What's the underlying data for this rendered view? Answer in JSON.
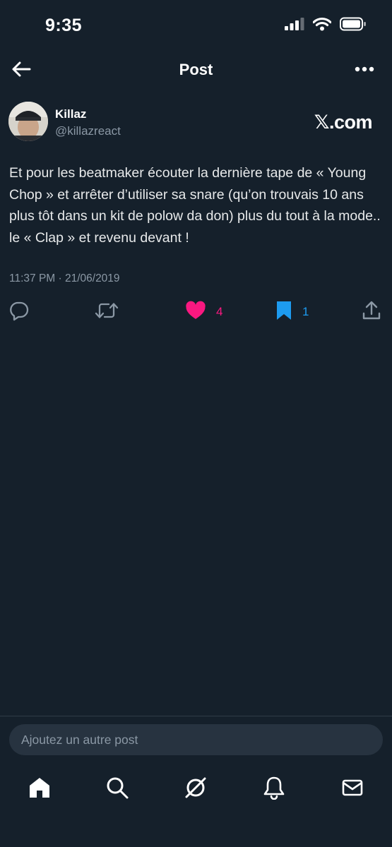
{
  "status_bar": {
    "time": "9:35"
  },
  "header": {
    "title": "Post"
  },
  "author": {
    "name": "Killaz",
    "handle": "@killazreact",
    "source": "𝕏.com"
  },
  "post": {
    "text": "Et pour les beatmaker écouter la dernière tape de « Young Chop » et arrêter d’utiliser sa snare (qu’on trouvais 10 ans plus tôt dans un kit de polow da don) plus du tout à la mode.. le « Clap » et revenu devant !",
    "timestamp": "11:37 PM · 21/06/2019"
  },
  "actions": {
    "likes": "4",
    "bookmarks": "1"
  },
  "compose": {
    "placeholder": "Ajoutez un autre post"
  },
  "colors": {
    "background": "#15202b",
    "like": "#f91880",
    "bookmark": "#1d9bf0",
    "muted": "#8b98a5"
  },
  "nav": {
    "items": [
      "home-icon",
      "search-icon",
      "grok-icon",
      "notifications-icon",
      "messages-icon"
    ]
  }
}
